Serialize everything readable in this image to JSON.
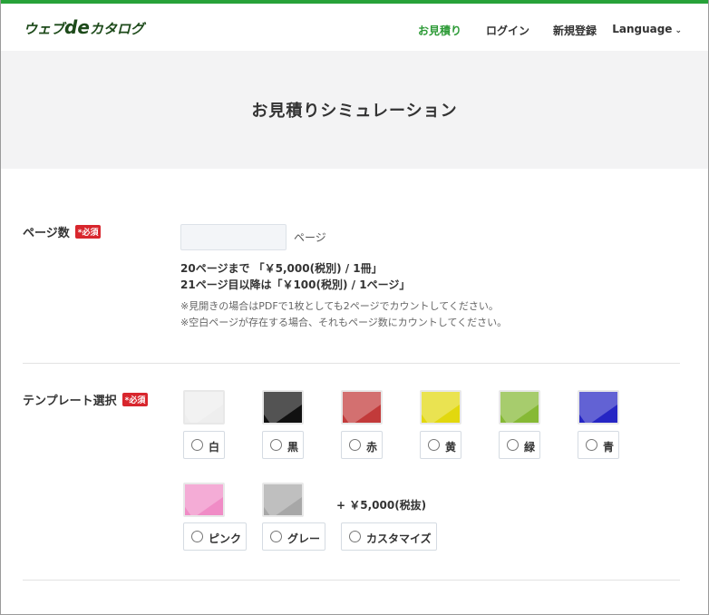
{
  "brand": {
    "logo_pre": "ウェブ",
    "logo_de": "de",
    "logo_post": "カタログ",
    "accent": "#27a239"
  },
  "nav": {
    "quote": "お見積り",
    "login": "ログイン",
    "register": "新規登録",
    "language": "Language",
    "caret": "⌄"
  },
  "hero": {
    "title": "お見積りシミュレーション"
  },
  "pages": {
    "label": "ページ数",
    "required": "*必須",
    "input_value": "",
    "unit": "ページ",
    "price1": "20ページまで 「￥5,000(税別) / 1冊」",
    "price2": "21ページ目以降は「￥100(税別) / 1ページ」",
    "note1": "※見開きの場合はPDFで1枚としても2ページでカウントしてください。",
    "note2": "※空白ページが存在する場合、それもページ数にカウントしてください。"
  },
  "template": {
    "label": "テンプレート選択",
    "required": "*必須",
    "options": [
      {
        "label": "白",
        "color": "#eeeeee"
      },
      {
        "label": "黒",
        "color": "#111111"
      },
      {
        "label": "赤",
        "color": "#c23a3a"
      },
      {
        "label": "黄",
        "color": "#e2d80e"
      },
      {
        "label": "緑",
        "color": "#86b935"
      },
      {
        "label": "青",
        "color": "#2626c4"
      },
      {
        "label": "ピンク",
        "color": "#f08cc6"
      },
      {
        "label": "グレー",
        "color": "#a7a7a7"
      },
      {
        "label": "カスタマイズ",
        "color": ""
      }
    ],
    "custom_price": "+ ￥5,000(税抜)"
  }
}
